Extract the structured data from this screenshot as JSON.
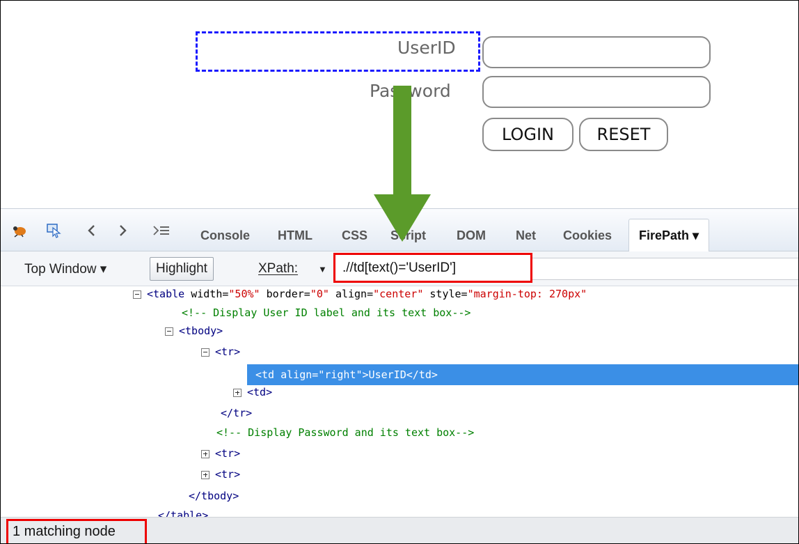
{
  "form": {
    "userid_label": "UserID",
    "password_label": "Password",
    "login_label": "LOGIN",
    "reset_label": "RESET"
  },
  "toolbar": {
    "tabs": [
      {
        "label": "Console"
      },
      {
        "label": "HTML"
      },
      {
        "label": "CSS"
      },
      {
        "label": "Script"
      },
      {
        "label": "DOM"
      },
      {
        "label": "Net"
      },
      {
        "label": "Cookies"
      },
      {
        "label": "FirePath ▾"
      }
    ],
    "icons": [
      "firebug-icon",
      "inspect-icon",
      "back-icon",
      "forward-icon",
      "command-line-icon"
    ]
  },
  "subbar": {
    "top_window_label": "Top Window ▾",
    "highlight_label": "Highlight",
    "xpath_label": "XPath:",
    "xpath_value": ".//td[text()='UserID']"
  },
  "tree": {
    "table_tag": "<table ",
    "table_attrs": [
      {
        "name": "width",
        "value": "\"50%\""
      },
      {
        "name": "border",
        "value": "\"0\""
      },
      {
        "name": "align",
        "value": "\"center\""
      },
      {
        "name": "style",
        "value": "\"margin-top: 270px\""
      }
    ],
    "comment_userid": "<!-- Display User ID label and its text box-->",
    "tbody_open": "<tbody>",
    "tr_open": "<tr>",
    "selected_line": "<td align=\"right\">UserID</td>",
    "td_collapsed": "<td>",
    "tr_close": "</tr>",
    "comment_password": "<!-- Display Password and its text box-->",
    "tr_collapsed_1": "<tr>",
    "tr_collapsed_2": "<tr>",
    "tbody_close": "</tbody>",
    "table_close": "</table>"
  },
  "status": {
    "text": "1 matching node"
  },
  "colors": {
    "highlight_dashes": "#1a1aff",
    "annotation_red": "#ee0000",
    "arrow_green": "#5b9b2a",
    "selection_blue": "#3b8fe6"
  }
}
